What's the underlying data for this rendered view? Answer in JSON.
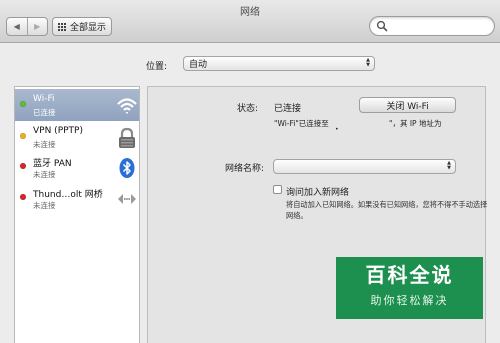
{
  "window": {
    "title": "网络"
  },
  "toolbar": {
    "back_glyph": "◀",
    "forward_glyph": "▶",
    "show_all_label": "全部显示",
    "search_placeholder": ""
  },
  "location": {
    "label": "位置:",
    "value": "自动"
  },
  "services": [
    {
      "name": "Wi-Fi",
      "status": "已连接",
      "dot_color": "#5fbf3a",
      "icon": "wifi-icon",
      "selected": true
    },
    {
      "name": "VPN (PPTP)",
      "status": "未连接",
      "dot_color": "#e8b21f",
      "icon": "vpn-lock-icon",
      "selected": false
    },
    {
      "name": "蓝牙 PAN",
      "status": "未连接",
      "dot_color": "#d8262b",
      "icon": "bluetooth-icon",
      "selected": false
    },
    {
      "name": "Thund…olt 网桥",
      "status": "未连接",
      "dot_color": "#d8262b",
      "icon": "thunderbolt-bridge-icon",
      "selected": false
    }
  ],
  "detail": {
    "status_label": "状态:",
    "status_value": "已连接",
    "wifi_off_button": "关闭 Wi-Fi",
    "status_desc_left": "\"Wi-Fi\"已连接至",
    "status_desc_dot": "•",
    "status_desc_right": "\"，其 IP 地址为",
    "network_name_label": "网络名称:",
    "network_name_value": "",
    "ask_join_label": "询问加入新网络",
    "ask_join_checked": false,
    "ask_join_note": "将自动加入已知网络。如果没有已知网络，您将不得不手动选择网络。"
  },
  "watermark": {
    "title": "百科全说",
    "subtitle": "助你轻松解决"
  }
}
